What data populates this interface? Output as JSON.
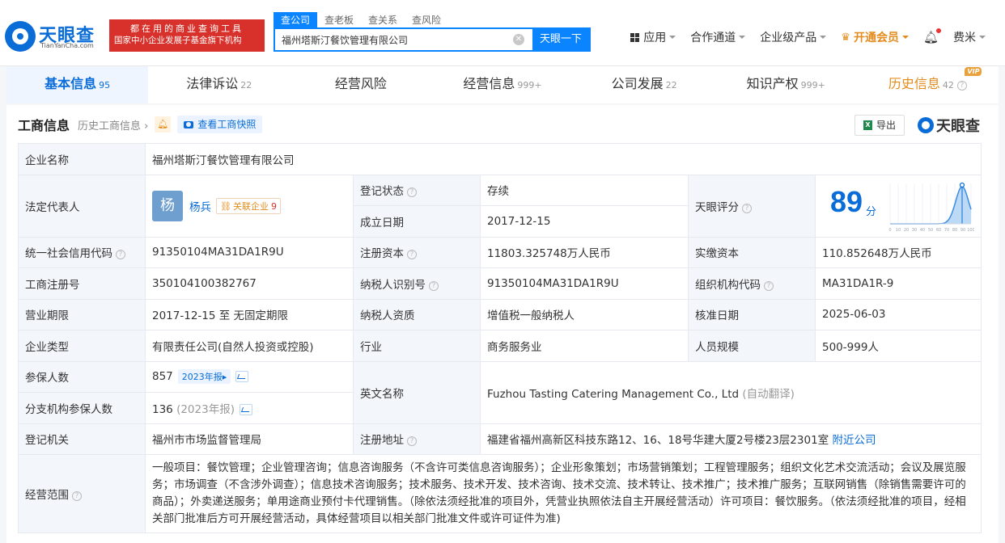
{
  "header": {
    "logo_name": "天眼查",
    "logo_domain": "TianYanCha.com",
    "slogan_line1": "都在用的商业查询工具",
    "slogan_line2": "国家中小企业发展子基金旗下机构",
    "search_tabs": [
      "查公司",
      "查老板",
      "查关系",
      "查风险"
    ],
    "search_value": "福州塔斯汀餐饮管理有限公司",
    "search_button": "天眼一下",
    "nav": {
      "apps": "应用",
      "channel": "合作通道",
      "enterprise": "企业级产品",
      "vip": "开通会员",
      "user": "费米"
    }
  },
  "tabs": [
    {
      "label": "基本信息",
      "count": "95"
    },
    {
      "label": "法律诉讼",
      "count": "22"
    },
    {
      "label": "经营风险",
      "count": ""
    },
    {
      "label": "经营信息",
      "count": "999+"
    },
    {
      "label": "公司发展",
      "count": "22"
    },
    {
      "label": "知识产权",
      "count": "999+"
    },
    {
      "label": "历史信息",
      "count": "42",
      "badge": "VIP"
    }
  ],
  "section": {
    "title": "工商信息",
    "history_link": "历史工商信息",
    "snapshot_button": "查看工商快照",
    "export_button": "导出",
    "brand": "天眼查"
  },
  "info": {
    "company_name_label": "企业名称",
    "company_name": "福州塔斯汀餐饮管理有限公司",
    "legal_rep_label": "法定代表人",
    "legal_rep_avatar": "杨",
    "legal_rep_name": "杨兵",
    "related_label": "关联企业",
    "related_count": "9",
    "reg_status_label": "登记状态",
    "reg_status": "存续",
    "found_date_label": "成立日期",
    "found_date": "2017-12-15",
    "score_label": "天眼评分",
    "score": "89",
    "score_unit": "分",
    "credit_code_label": "统一社会信用代码",
    "credit_code": "91350104MA31DA1R9U",
    "reg_capital_label": "注册资本",
    "reg_capital": "11803.325748万人民币",
    "paid_capital_label": "实缴资本",
    "paid_capital": "110.852648万人民币",
    "reg_no_label": "工商注册号",
    "reg_no": "350104100382767",
    "taxpayer_id_label": "纳税人识别号",
    "taxpayer_id": "91350104MA31DA1R9U",
    "org_code_label": "组织机构代码",
    "org_code": "MA31DA1R-9",
    "term_label": "营业期限",
    "term": "2017-12-15 至 无固定期限",
    "taxpayer_qual_label": "纳税人资质",
    "taxpayer_qual": "增值税一般纳税人",
    "approve_date_label": "核准日期",
    "approve_date": "2025-06-03",
    "type_label": "企业类型",
    "type": "有限责任公司(自然人投资或控股)",
    "industry_label": "行业",
    "industry": "商务服务业",
    "staff_size_label": "人员规模",
    "staff_size": "500-999人",
    "insured_label": "参保人数",
    "insured": "857",
    "insured_year": "2023年报",
    "branch_insured_label": "分支机构参保人数",
    "branch_insured": "136",
    "branch_insured_year": "(2023年报)",
    "english_name_label": "英文名称",
    "english_name": "Fuzhou Tasting Catering Management Co., Ltd",
    "english_name_note": "(自动翻译)",
    "authority_label": "登记机关",
    "authority": "福州市市场监督管理局",
    "address_label": "注册地址",
    "address": "福建省福州高新区科技东路12、16、18号华建大厦2号楼23层2301室",
    "nearby_link": "附近公司",
    "scope_label": "经营范围",
    "scope": "一般项目：餐饮管理；企业管理咨询；信息咨询服务（不含许可类信息咨询服务）；企业形象策划；市场营销策划；工程管理服务；组织文化艺术交流活动；会议及展览服务；市场调查（不含涉外调查）；信息技术咨询服务；技术服务、技术开发、技术咨询、技术交流、技术转让、技术推广；技术推广服务；互联网销售（除销售需要许可的商品）；外卖递送服务；单用途商业预付卡代理销售。（除依法须经批准的项目外，凭营业执照依法自主开展经营活动）许可项目：餐饮服务。（依法须经批准的项目，经相关部门批准后方可开展经营活动，具体经营项目以相关部门批准文件或许可证件为准)"
  },
  "score_chart": {
    "ticks": [
      "0",
      "10",
      "20",
      "30",
      "40",
      "50",
      "60",
      "70",
      "80",
      "90",
      "100"
    ],
    "marker_value": 89,
    "colors": {
      "curve": "#3b8de0",
      "fill": "#bcd9f6",
      "marker": "#0a6cd6"
    }
  }
}
